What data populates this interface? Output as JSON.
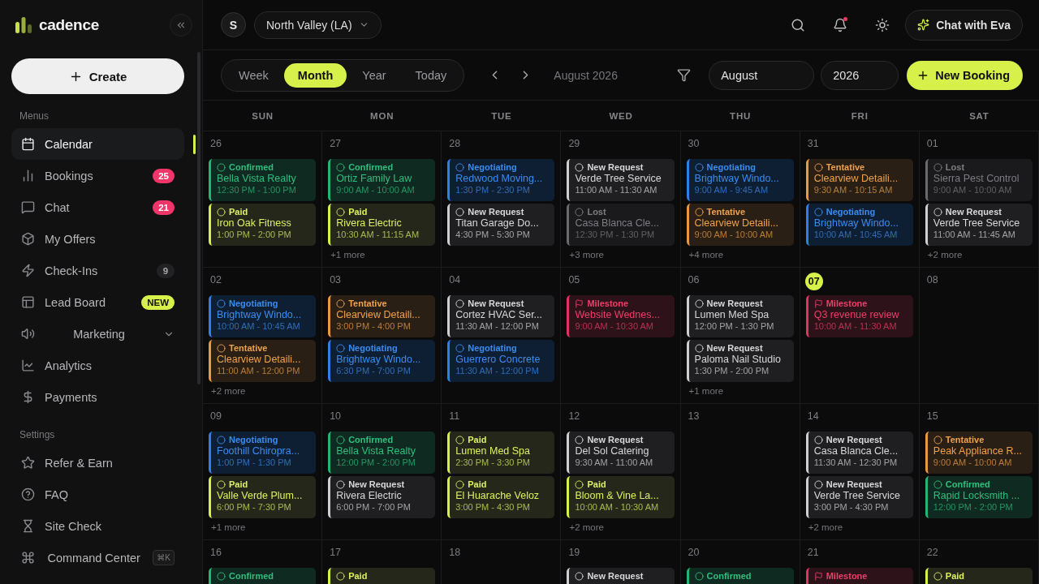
{
  "brand": {
    "name": "cadence"
  },
  "create_button": "Create",
  "sidebar": {
    "sections": [
      {
        "title": "Menus",
        "items": [
          {
            "label": "Calendar",
            "selected": true
          },
          {
            "label": "Bookings",
            "selected": false,
            "badge": {
              "kind": "alert",
              "text": "25"
            }
          },
          {
            "label": "Chat",
            "selected": false,
            "badge": {
              "kind": "alert",
              "text": "21"
            }
          },
          {
            "label": "My Offers",
            "selected": false
          },
          {
            "label": "Check-Ins",
            "selected": false,
            "badge": {
              "kind": "count",
              "text": "9"
            }
          },
          {
            "label": "Lead Board",
            "selected": false,
            "badge": {
              "kind": "new",
              "text": "NEW"
            }
          },
          {
            "label": "Marketing",
            "selected": false,
            "expanded": false
          },
          {
            "label": "Analytics",
            "selected": false
          },
          {
            "label": "Payments",
            "selected": false
          }
        ]
      },
      {
        "title": "Settings",
        "items": [
          {
            "label": "Refer & Earn",
            "selected": false
          },
          {
            "label": "FAQ",
            "selected": false
          },
          {
            "label": "Site Check",
            "selected": false
          },
          {
            "label": "Command Center",
            "selected": false,
            "shortcut": "⌘K"
          }
        ]
      }
    ]
  },
  "topbar": {
    "avatar": "S",
    "location": "North Valley (LA)",
    "chat_button": "Chat with Eva",
    "notifications_unread": true
  },
  "toolbar": {
    "views": [
      {
        "label": "Week",
        "selected": false
      },
      {
        "label": "Month",
        "selected": true
      },
      {
        "label": "Year",
        "selected": false
      },
      {
        "label": "Today",
        "selected": false
      }
    ],
    "period": "August 2026",
    "month_field": "August",
    "year_field": "2026",
    "new_button": "New Booking"
  },
  "weekdays": [
    "SUN",
    "MON",
    "TUE",
    "WED",
    "THU",
    "FRI",
    "SAT"
  ],
  "weeks": [
    [
      {
        "day": "26",
        "today": false,
        "events": [
          {
            "kind": "confirmed",
            "status": "Confirmed",
            "name": "Bella Vista Realty",
            "time": "12:30 PM - 1:00 PM"
          },
          {
            "kind": "paid",
            "status": "Paid",
            "name": "Iron Oak Fitness",
            "time": "1:00 PM - 2:00 PM"
          }
        ]
      },
      {
        "day": "27",
        "today": false,
        "more": "+1 more",
        "events": [
          {
            "kind": "confirmed",
            "status": "Confirmed",
            "name": "Ortiz Family Law",
            "time": "9:00 AM - 10:00 AM"
          },
          {
            "kind": "paid",
            "status": "Paid",
            "name": "Rivera Electric",
            "time": "10:30 AM - 11:15 AM"
          }
        ]
      },
      {
        "day": "28",
        "today": false,
        "events": [
          {
            "kind": "negotiating",
            "status": "Negotiating",
            "name": "Redwood Moving...",
            "time": "1:30 PM - 2:30 PM"
          },
          {
            "kind": "new",
            "status": "New Request",
            "name": "Titan Garage Do...",
            "time": "4:30 PM - 5:30 PM"
          }
        ]
      },
      {
        "day": "29",
        "today": false,
        "more": "+3 more",
        "events": [
          {
            "kind": "new",
            "status": "New Request",
            "name": "Verde Tree Service",
            "time": "11:00 AM - 11:30 AM"
          },
          {
            "kind": "lost",
            "status": "Lost",
            "name": "Casa Blanca Cle...",
            "time": "12:30 PM - 1:30 PM"
          }
        ]
      },
      {
        "day": "30",
        "today": false,
        "more": "+4 more",
        "events": [
          {
            "kind": "negotiating",
            "status": "Negotiating",
            "name": "Brightway Windo...",
            "time": "9:00 AM - 9:45 AM"
          },
          {
            "kind": "tentative",
            "status": "Tentative",
            "name": "Clearview Detaili...",
            "time": "9:00 AM - 10:00 AM"
          }
        ]
      },
      {
        "day": "31",
        "today": false,
        "events": [
          {
            "kind": "tentative",
            "status": "Tentative",
            "name": "Clearview Detaili...",
            "time": "9:30 AM - 10:15 AM"
          },
          {
            "kind": "negotiating",
            "status": "Negotiating",
            "name": "Brightway Windo...",
            "time": "10:00 AM - 10:45 AM"
          }
        ]
      },
      {
        "day": "01",
        "today": false,
        "more": "+2 more",
        "events": [
          {
            "kind": "lost",
            "status": "Lost",
            "name": "Sierra Pest Control",
            "time": "9:00 AM - 10:00 AM"
          },
          {
            "kind": "new",
            "status": "New Request",
            "name": "Verde Tree Service",
            "time": "11:00 AM - 11:45 AM"
          }
        ]
      }
    ],
    [
      {
        "day": "02",
        "today": false,
        "more": "+2 more",
        "events": [
          {
            "kind": "negotiating",
            "status": "Negotiating",
            "name": "Brightway Windo...",
            "time": "10:00 AM - 10:45 AM"
          },
          {
            "kind": "tentative",
            "status": "Tentative",
            "name": "Clearview Detaili...",
            "time": "11:00 AM - 12:00 PM"
          }
        ]
      },
      {
        "day": "03",
        "today": false,
        "events": [
          {
            "kind": "tentative",
            "status": "Tentative",
            "name": "Clearview Detaili...",
            "time": "3:00 PM - 4:00 PM"
          },
          {
            "kind": "negotiating",
            "status": "Negotiating",
            "name": "Brightway Windo...",
            "time": "6:30 PM - 7:00 PM"
          }
        ]
      },
      {
        "day": "04",
        "today": false,
        "events": [
          {
            "kind": "new",
            "status": "New Request",
            "name": "Cortez HVAC Ser...",
            "time": "11:30 AM - 12:00 PM"
          },
          {
            "kind": "negotiating",
            "status": "Negotiating",
            "name": "Guerrero Concrete",
            "time": "11:30 AM - 12:00 PM"
          }
        ]
      },
      {
        "day": "05",
        "today": false,
        "events": [
          {
            "kind": "milestone",
            "status": "Milestone",
            "name": "Website Wednes...",
            "time": "9:00 AM - 10:30 AM"
          }
        ]
      },
      {
        "day": "06",
        "today": false,
        "more": "+1 more",
        "events": [
          {
            "kind": "new",
            "status": "New Request",
            "name": "Lumen Med Spa",
            "time": "12:00 PM - 1:30 PM"
          },
          {
            "kind": "new",
            "status": "New Request",
            "name": "Paloma Nail Studio",
            "time": "1:30 PM - 2:00 PM"
          }
        ]
      },
      {
        "day": "07",
        "today": true,
        "events": [
          {
            "kind": "milestone",
            "status": "Milestone",
            "name": "Q3 revenue review",
            "time": "10:00 AM - 11:30 AM"
          }
        ]
      },
      {
        "day": "08",
        "today": false
      }
    ],
    [
      {
        "day": "09",
        "today": false,
        "more": "+1 more",
        "events": [
          {
            "kind": "negotiating",
            "status": "Negotiating",
            "name": "Foothill Chiropra...",
            "time": "1:00 PM - 1:30 PM"
          },
          {
            "kind": "paid",
            "status": "Paid",
            "name": "Valle Verde Plum...",
            "time": "6:00 PM - 7:30 PM"
          }
        ]
      },
      {
        "day": "10",
        "today": false,
        "events": [
          {
            "kind": "confirmed",
            "status": "Confirmed",
            "name": "Bella Vista Realty",
            "time": "12:00 PM - 2:00 PM"
          },
          {
            "kind": "new",
            "status": "New Request",
            "name": "Rivera Electric",
            "time": "6:00 PM - 7:00 PM"
          }
        ]
      },
      {
        "day": "11",
        "today": false,
        "events": [
          {
            "kind": "paid",
            "status": "Paid",
            "name": "Lumen Med Spa",
            "time": "2:30 PM - 3:30 PM"
          },
          {
            "kind": "paid",
            "status": "Paid",
            "name": "El Huarache Veloz",
            "time": "3:00 PM - 4:30 PM"
          }
        ]
      },
      {
        "day": "12",
        "today": false,
        "more": "+2 more",
        "events": [
          {
            "kind": "new",
            "status": "New Request",
            "name": "Del Sol Catering",
            "time": "9:30 AM - 11:00 AM"
          },
          {
            "kind": "paid",
            "status": "Paid",
            "name": "Bloom & Vine La...",
            "time": "10:00 AM - 10:30 AM"
          }
        ]
      },
      {
        "day": "13",
        "today": false
      },
      {
        "day": "14",
        "today": false,
        "more": "+2 more",
        "events": [
          {
            "kind": "new",
            "status": "New Request",
            "name": "Casa Blanca Cle...",
            "time": "11:30 AM - 12:30 PM"
          },
          {
            "kind": "new",
            "status": "New Request",
            "name": "Verde Tree Service",
            "time": "3:00 PM - 4:30 PM"
          }
        ]
      },
      {
        "day": "15",
        "today": false,
        "events": [
          {
            "kind": "tentative",
            "status": "Tentative",
            "name": "Peak Appliance R...",
            "time": "9:00 AM - 10:00 AM"
          },
          {
            "kind": "confirmed",
            "status": "Confirmed",
            "name": "Rapid Locksmith ...",
            "time": "12:00 PM - 2:00 PM"
          }
        ]
      }
    ],
    [
      {
        "day": "16",
        "today": false,
        "events": [
          {
            "kind": "confirmed",
            "status": "Confirmed"
          }
        ]
      },
      {
        "day": "17",
        "today": false,
        "events": [
          {
            "kind": "paid",
            "status": "Paid"
          }
        ]
      },
      {
        "day": "18",
        "today": false
      },
      {
        "day": "19",
        "today": false,
        "events": [
          {
            "kind": "new",
            "status": "New Request"
          }
        ]
      },
      {
        "day": "20",
        "today": false,
        "events": [
          {
            "kind": "confirmed",
            "status": "Confirmed"
          }
        ]
      },
      {
        "day": "21",
        "today": false,
        "events": [
          {
            "kind": "milestone",
            "status": "Milestone"
          }
        ]
      },
      {
        "day": "22",
        "today": false,
        "events": [
          {
            "kind": "paid",
            "status": "Paid"
          }
        ]
      }
    ]
  ]
}
